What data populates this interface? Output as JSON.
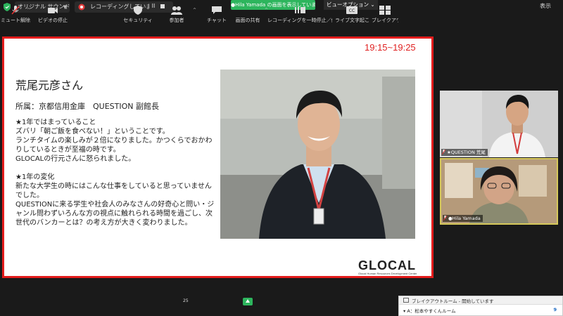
{
  "top_bar": {
    "sound_label": "オリジナル サウンド: オフ",
    "recording_label": "レコーディングしています...",
    "recording_pause": "II",
    "share_banner": "●Hila  Yamada の画面を表示しています",
    "view_options": "ビューオプション ⌄",
    "view_label": "表示"
  },
  "slide": {
    "time": "19:15~19:25",
    "name": "荒尾元彦さん",
    "affiliation": "所属：京都信用金庫　QUESTION 副館長",
    "paragraphs": [
      "★1年ではまっていること",
      "ズバリ「朝ご飯を食べない！」ということです。",
      "ランチタイムの楽しみが２倍になりました。かつくらでおかわりしているときが至福の時です。",
      "GLOCALの行元さんに怒られました。",
      "",
      "★1年の変化",
      "新たな大学生の時にはこんな仕事をしていると思っていませんでした。",
      "QUESTIONに来る学生や社会人のみなさんの好奇心と問い・ジャンル問わずいろんな方の視点に触れられる時間を過ごし、次世代のバンカーとは？の考え方が大きく変わりました。"
    ],
    "logo_text": "GLOCAL",
    "logo_sub": "Glocal Human Resources Development Center"
  },
  "videos": [
    {
      "label": "★QUESTION 荒尾"
    },
    {
      "label": "●Hila Yamada"
    }
  ],
  "toolbar": {
    "items": [
      {
        "label": "ミュート解除"
      },
      {
        "label": "ビデオの停止"
      },
      {
        "label": "セキュリティ"
      },
      {
        "label": "参加者"
      },
      {
        "label": "チャット"
      },
      {
        "label": "画面の共有"
      },
      {
        "label": "レコーディングを一時停止／停止"
      },
      {
        "label": "ライブ文字起こし"
      },
      {
        "label": "ブレイクアウトル"
      }
    ],
    "participant_count": "25"
  },
  "breakout_popup": {
    "header": "ブレイクアウトルーム - 開始しています",
    "room": "▾  A：松本やすくんルーム",
    "count": "9"
  },
  "colors": {
    "accent_red": "#e31c1c",
    "share_green": "#2db55d",
    "active_speaker": "#d6c85a"
  }
}
